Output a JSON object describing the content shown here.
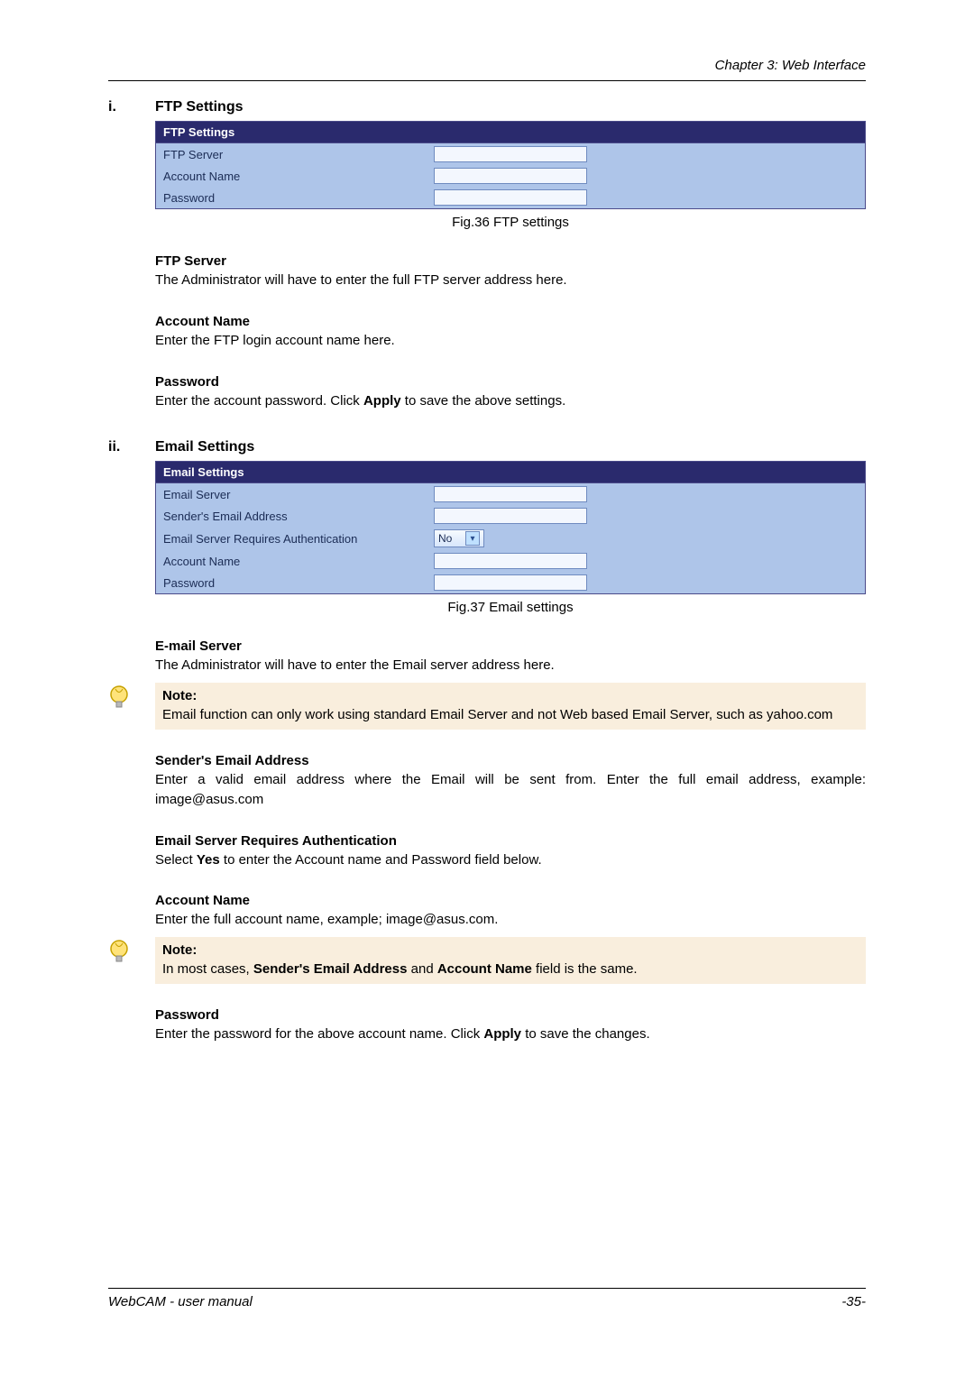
{
  "header": {
    "chapter": "Chapter 3: Web Interface"
  },
  "sec1": {
    "num": "i.",
    "title": "FTP Settings",
    "box_header": "FTP Settings",
    "rows": {
      "r0": "FTP Server",
      "r1": "Account Name",
      "r2": "Password"
    },
    "caption": "Fig.36  FTP settings",
    "h1": "FTP Server",
    "p1": "The Administrator will have to enter the full FTP server address here.",
    "h2": "Account Name",
    "p2": "Enter the FTP login account name here.",
    "h3": "Password",
    "p3a": "Enter the account password.    Click ",
    "p3bold": "Apply",
    "p3b": " to save the above settings."
  },
  "sec2": {
    "num": "ii.",
    "title": "Email Settings",
    "box_header": "Email Settings",
    "rows": {
      "r0": "Email Server",
      "r1": "Sender's Email Address",
      "r2": "Email Server Requires Authentication",
      "r3": "Account Name",
      "r4": "Password"
    },
    "select_val": "No",
    "caption": "Fig.37  Email settings",
    "h1": "E-mail Server",
    "p1": "The Administrator will have to enter the Email server address here.",
    "note1": {
      "label": "Note:",
      "body": "Email function can only work using standard Email Server and not Web based Email Server, such as yahoo.com"
    },
    "h2": "Sender's Email Address",
    "p2": "Enter a valid email address where the Email will be sent from.  Enter the full email address, example: image@asus.com",
    "h3": "Email Server Requires Authentication",
    "p3a": "Select ",
    "p3bold": "Yes",
    "p3b": " to enter the Account name and Password field below.",
    "h4": "Account Name",
    "p4": "Enter the full account name, example; image@asus.com.",
    "note2": {
      "label": "Note:",
      "a": "In most cases, ",
      "b1": "Sender's Email Address",
      "mid": " and ",
      "b2": "Account Name",
      "c": " field is the same."
    },
    "h5": "Password",
    "p5a": "Enter the password for the above account name.  Click ",
    "p5bold": "Apply",
    "p5b": " to save the changes."
  },
  "footer": {
    "left": "WebCAM - user manual",
    "right": "-35-"
  }
}
